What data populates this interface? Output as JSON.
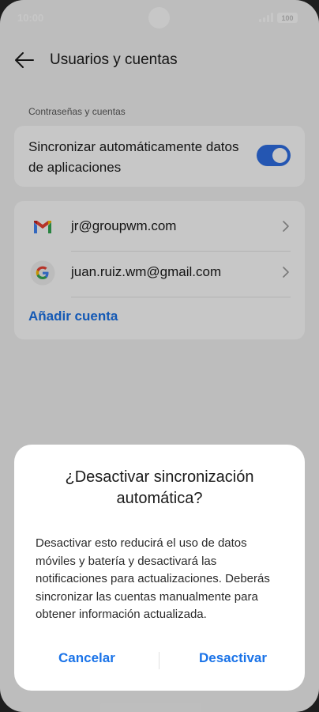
{
  "status": {
    "time": "10:00",
    "battery": "100"
  },
  "header": {
    "title": "Usuarios y cuentas"
  },
  "section": {
    "label": "Contraseñas y cuentas"
  },
  "sync": {
    "label": "Sincronizar automáticamente datos de aplicaciones",
    "enabled": true
  },
  "accounts": [
    {
      "email": "jr@groupwm.com",
      "icon": "gmail-icon"
    },
    {
      "email": "juan.ruiz.wm@gmail.com",
      "icon": "google-icon"
    }
  ],
  "add_account": "Añadir cuenta",
  "dialog": {
    "title": "¿Desactivar sincronización automática?",
    "body": "Desactivar esto reducirá el uso de datos móviles y batería y desactivará las notificaciones para actualizaciones. Deberás sincronizar las cuentas manualmente para obtener información actualizada.",
    "cancel": "Cancelar",
    "confirm": "Desactivar"
  },
  "colors": {
    "accent": "#1a73e8",
    "toggle": "#2f6fe4",
    "background": "#f3f3f3"
  }
}
